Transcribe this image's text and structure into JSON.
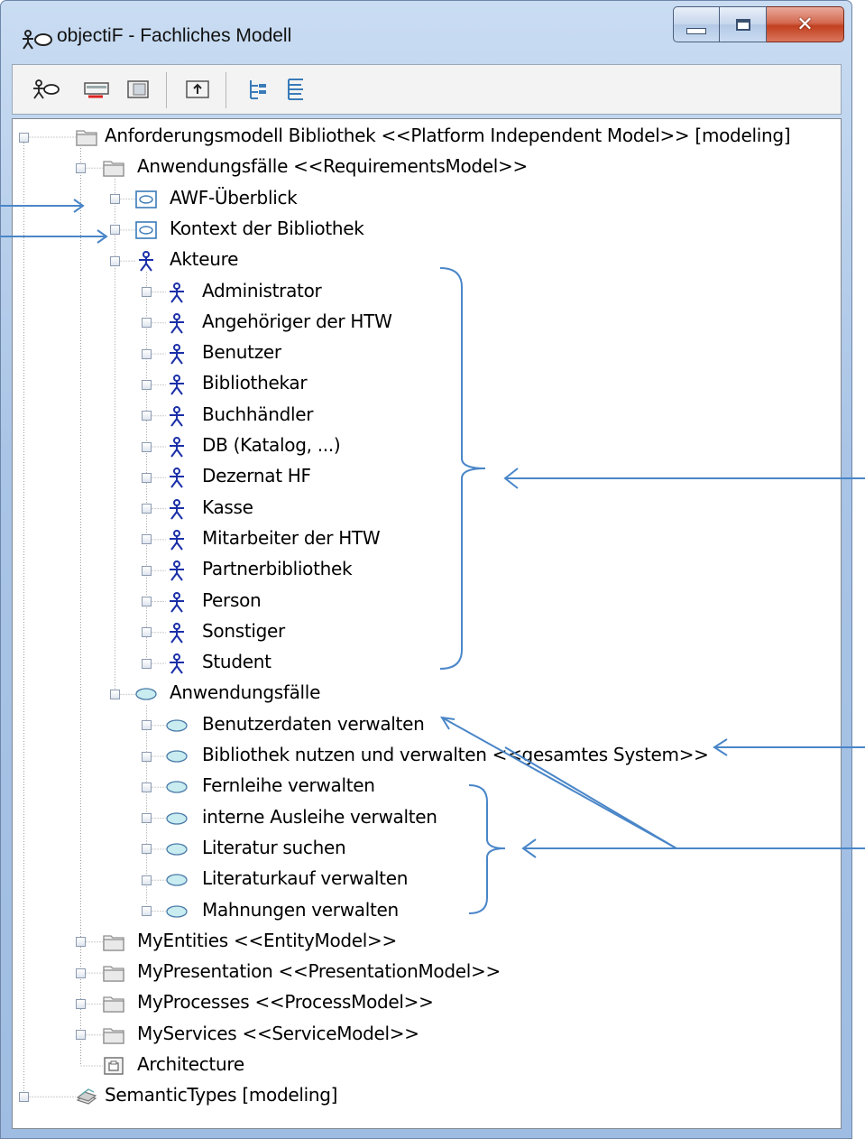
{
  "window": {
    "title": "objectiF - Fachliches Modell",
    "accent": "#a9c4e6",
    "close_color": "#c2401f"
  },
  "toolbar": {
    "buttons": [
      "actor-model-icon",
      "remove-icon",
      "properties-icon",
      "up-folder-icon",
      "tree-view-icon",
      "list-view-icon"
    ]
  },
  "tree": {
    "root": "Anforderungsmodell Bibliothek <<Platform Independent Model>> [modeling]",
    "requirements": "Anwendungsfälle <<RequirementsModel>>",
    "diagram_overview": "AWF-Überblick",
    "diagram_context": "Kontext der Bibliothek",
    "actors_folder": "Akteure",
    "actors": [
      "Administrator",
      "Angehöriger der HTW",
      "Benutzer",
      "Bibliothekar",
      "Buchhändler",
      "DB (Katalog, ...)",
      "Dezernat HF",
      "Kasse",
      "Mitarbeiter der HTW",
      "Partnerbibliothek",
      "Person",
      "Sonstiger",
      "Student"
    ],
    "usecases_folder": "Anwendungsfälle",
    "usecases": [
      "Benutzerdaten  verwalten",
      "Bibliothek nutzen und verwalten <<gesamtes System>>",
      "Fernleihe verwalten",
      "interne Ausleihe verwalten",
      "Literatur suchen",
      "Literaturkauf verwalten",
      "Mahnungen verwalten"
    ],
    "models": [
      "MyEntities <<EntityModel>>",
      "MyPresentation <<PresentationModel>>",
      "MyProcesses <<ProcessModel>>",
      "MyServices <<ServiceModel>>"
    ],
    "architecture": "Architecture",
    "semantic_types": "SemanticTypes [modeling]",
    "expander_minus": "−",
    "expander_plus": "+"
  },
  "colors": {
    "annotation": "#4a86c8",
    "actor_icon": "#1a2fa8",
    "usecase_fill": "#c8ecf0"
  }
}
